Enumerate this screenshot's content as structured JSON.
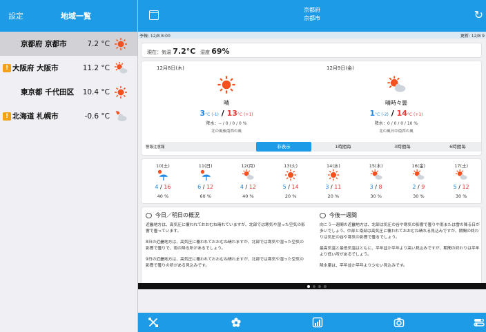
{
  "sidebar": {
    "settings_label": "設定",
    "title": "地域一覧",
    "cities": [
      {
        "name": "京都府 京都市",
        "temp": "7.2 °C",
        "icon": "sunny-icon",
        "warning": false,
        "selected": true
      },
      {
        "name": "大阪府 大阪市",
        "temp": "11.2 °C",
        "icon": "sunny-cloudy-icon",
        "warning": true,
        "warning_mark": "!",
        "selected": false
      },
      {
        "name": "東京都 千代田区",
        "temp": "10.4 °C",
        "icon": "sunny-icon",
        "warning": false,
        "selected": false
      },
      {
        "name": "北海道 札幌市",
        "temp": "-0.6 °C",
        "icon": "cloudy-rain-icon",
        "warning": true,
        "warning_mark": "!",
        "selected": false
      }
    ]
  },
  "header": {
    "prefecture": "京都府",
    "city": "京都市"
  },
  "update_bar": {
    "left": "予報: 12/8 8:00",
    "right": "更新: 12/8 9"
  },
  "current": {
    "label": "現在：気温",
    "temp": "7.2°C",
    "humidity_label": "湿度",
    "humidity": "69%"
  },
  "days": [
    {
      "date": "12月8日(木)",
      "icon": "sunny-icon",
      "weather": "晴",
      "low": "3",
      "low_diff": "°C (-1)",
      "separator": " / ",
      "high": "13",
      "high_diff": "°C (+1)",
      "rain": "降水：-- / 0 / 0 / 0 %",
      "wind": "北の風後南西の風"
    },
    {
      "date": "12月9日(金)",
      "icon": "sunny-cloudy-icon",
      "weather": "晴時々曇",
      "low": "1",
      "low_diff": "°C (-2)",
      "separator": " / ",
      "high": "14",
      "high_diff": "°C (+1)",
      "rain": "降水：0 / 0 / 0 / 10 %",
      "wind": "北の風日中南西の風"
    }
  ],
  "warnings": {
    "label": "警報注意報",
    "segments": [
      "非表示",
      "1時間毎",
      "3時間毎",
      "6時間毎"
    ],
    "active_index": 0
  },
  "week": [
    {
      "date": "10(土)",
      "icon": "umbrella-sun-icon",
      "low": "4",
      "high": "16",
      "pop": "40 %"
    },
    {
      "date": "11(日)",
      "icon": "umbrella-sun-icon",
      "low": "6",
      "high": "12",
      "pop": "60 %"
    },
    {
      "date": "12(月)",
      "icon": "sunny-cloudy-icon",
      "low": "4",
      "high": "12",
      "pop": "40 %"
    },
    {
      "date": "13(火)",
      "icon": "sunny-icon",
      "low": "5",
      "high": "14",
      "pop": "20 %"
    },
    {
      "date": "14(水)",
      "icon": "sunny-icon",
      "low": "3",
      "high": "11",
      "pop": "20 %"
    },
    {
      "date": "15(木)",
      "icon": "sunny-cloudy-icon",
      "low": "3",
      "high": "8",
      "pop": "30 %"
    },
    {
      "date": "16(金)",
      "icon": "sunny-cloudy-icon",
      "low": "2",
      "high": "9",
      "pop": "30 %"
    },
    {
      "date": "17(土)",
      "icon": "sunny-cloudy-icon",
      "low": "5",
      "high": "12",
      "pop": "30 %"
    }
  ],
  "outlook": {
    "today_title": "今日／明日の概況",
    "today_paragraphs": [
      "近畿地方は、高気圧に覆われておおむね晴れていますが、北部では寒気や湿った空気の影響で曇っています。",
      "8日の近畿地方は、高気圧に覆われておおむね晴れますが、北部では寒気や湿った空気の影響で曇りで、雨の降る所があるでしょう。",
      "9日の近畿地方は、高気圧に覆われておおむね晴れますが、北部では寒気や湿った空気の影響で曇りの所がある見込みです。"
    ],
    "week_title": "今後一週間",
    "week_paragraphs": [
      "向こう一週間の近畿地方は、北部は気圧の谷や寒気の影響で曇りや雨または雪の降る日が多いでしょう。中部と南部は高気圧に覆われておおむね晴れる見込みですが、期間の終わりは気圧の谷や寒気の影響で曇るでしょう。",
      "最高気温と最低気温はともに、平年並か平年より高い見込みですが、期間の終わりは平年より低い所があるでしょう。",
      "降水量は、平年並か平年より少ない見込みです。"
    ]
  },
  "pager": {
    "count": 4,
    "active": 0
  },
  "tabbar": {
    "items": [
      "tools-icon",
      "flower-icon",
      "chart-icon",
      "camera-icon",
      "settings-switch-icon"
    ]
  },
  "colors": {
    "accent": "#1e9be6",
    "low_temp": "#1e88e5",
    "high_temp": "#e53935",
    "warning": "#f2a118",
    "sun": "#f4511e"
  }
}
